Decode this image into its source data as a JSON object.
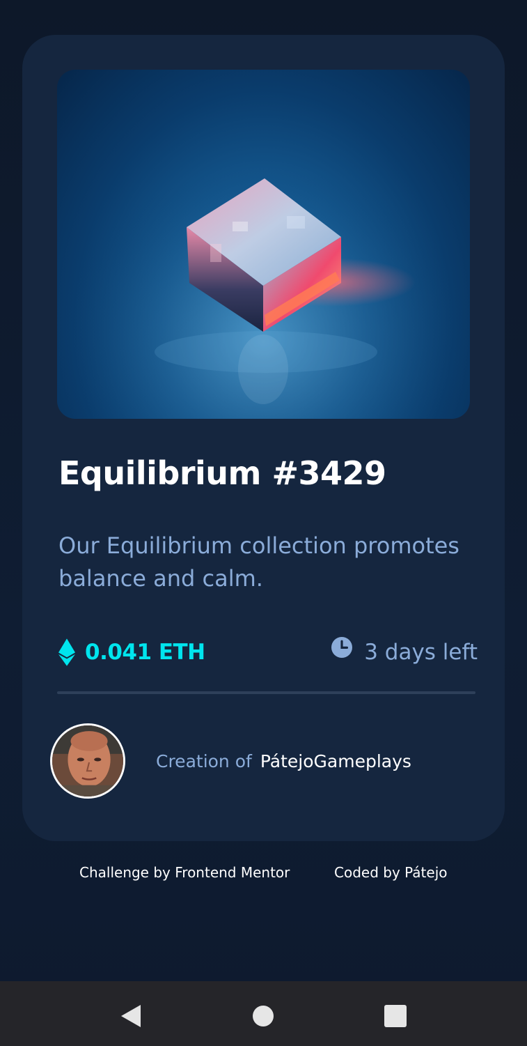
{
  "card": {
    "title": "Equilibrium #3429",
    "description": "Our Equilibrium collection promotes balance and calm.",
    "price": "0.041 ETH",
    "time_left": "3 days left",
    "creation_label": "Creation of",
    "creator_name": "PátejoGameplays"
  },
  "footer": {
    "challenge": "Challenge by Frontend Mentor",
    "coded_by": "Coded by Pátejo"
  },
  "icons": {
    "price": "ethereum-icon",
    "time": "clock-icon",
    "nav": [
      "back-icon",
      "home-icon",
      "recents-icon"
    ]
  },
  "colors": {
    "page_bg": "#0d1a2e",
    "card_bg": "#15263f",
    "accent_cyan": "#00e5ee",
    "soft_blue": "#8bacd9",
    "white": "#ffffff",
    "navbar_bg": "#252529"
  }
}
